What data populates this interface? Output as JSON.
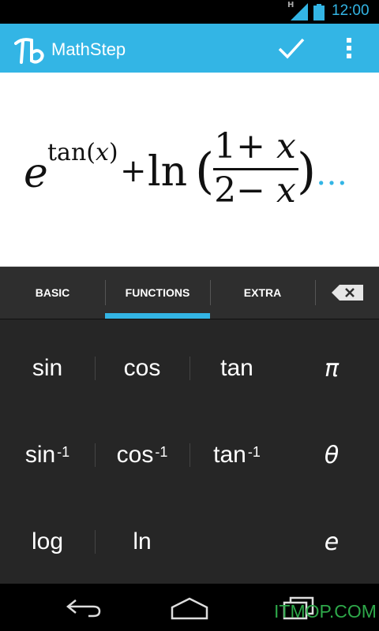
{
  "status_bar": {
    "network_type": "H",
    "time": "12:00"
  },
  "action_bar": {
    "app_title": "MathStep",
    "logo_icon": "mathstep-logo-icon",
    "confirm_icon": "check-icon",
    "overflow_icon": "overflow-menu-icon"
  },
  "expression": {
    "base": "e",
    "exponent_func": "tan(",
    "exponent_var": "x",
    "exponent_close": ")",
    "plus": "+",
    "func": "ln",
    "open_paren": "(",
    "numerator_left": "1+ ",
    "numerator_var": "x",
    "denominator_left": "2− ",
    "denominator_var": "x",
    "close_paren": ")",
    "continuation": "…"
  },
  "tabs": [
    {
      "label": "BASIC",
      "selected": false
    },
    {
      "label": "FUNCTIONS",
      "selected": true
    },
    {
      "label": "EXTRA",
      "selected": false
    }
  ],
  "backspace_icon": "backspace-icon",
  "keypad": {
    "rows": [
      [
        {
          "label": "sin",
          "sup": ""
        },
        {
          "label": "cos",
          "sup": ""
        },
        {
          "label": "tan",
          "sup": ""
        },
        {
          "label": "π",
          "sup": ""
        }
      ],
      [
        {
          "label": "sin",
          "sup": "-1"
        },
        {
          "label": "cos",
          "sup": "-1"
        },
        {
          "label": "tan",
          "sup": "-1"
        },
        {
          "label": "θ",
          "sup": ""
        }
      ],
      [
        {
          "label": "log",
          "sup": ""
        },
        {
          "label": "ln",
          "sup": ""
        },
        {
          "label": "",
          "sup": ""
        },
        {
          "label": "e",
          "sup": ""
        }
      ]
    ]
  },
  "nav_bar": {
    "back_icon": "back-icon",
    "home_icon": "home-icon",
    "recent_icon": "recent-apps-icon"
  },
  "watermark": "ITMOP.COM",
  "colors": {
    "accent": "#33b5e5",
    "keypad_bg": "#262626",
    "tab_bg": "#2e2e2e",
    "watermark": "#2ea84a"
  }
}
